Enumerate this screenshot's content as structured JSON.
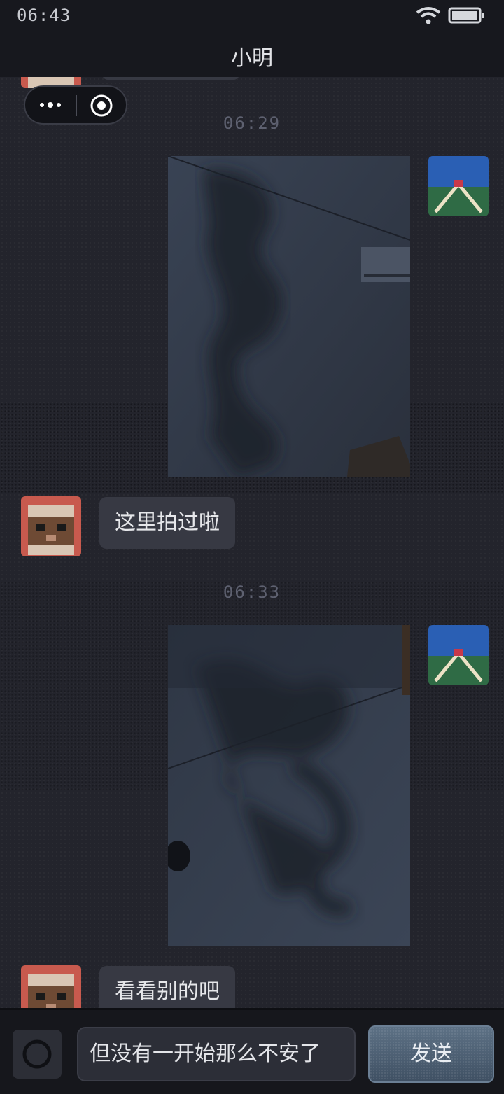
{
  "status_bar": {
    "time": "06:43",
    "wifi_icon": "wifi-icon",
    "battery_icon": "battery-icon"
  },
  "header": {
    "title": "小明"
  },
  "capsule": {
    "more_icon": "more-dots-icon",
    "record_icon": "record-circle-icon"
  },
  "messages": [
    {
      "type": "timestamp",
      "text": "06:29"
    },
    {
      "type": "image",
      "side": "right",
      "sender": "me",
      "description": "photo"
    },
    {
      "type": "text",
      "side": "left",
      "sender": "小明",
      "text": "这里拍过啦"
    },
    {
      "type": "timestamp",
      "text": "06:33"
    },
    {
      "type": "image",
      "side": "right",
      "sender": "me",
      "description": "photo"
    },
    {
      "type": "text",
      "side": "left",
      "sender": "小明",
      "text": "看看别的吧"
    }
  ],
  "composer": {
    "camera_icon": "camera-icon",
    "input_value": "但没有一开始那么不安了",
    "send_label": "发送"
  },
  "colors": {
    "background": "#23242c",
    "bubble": "#373943",
    "send_button": "#4e6276"
  }
}
